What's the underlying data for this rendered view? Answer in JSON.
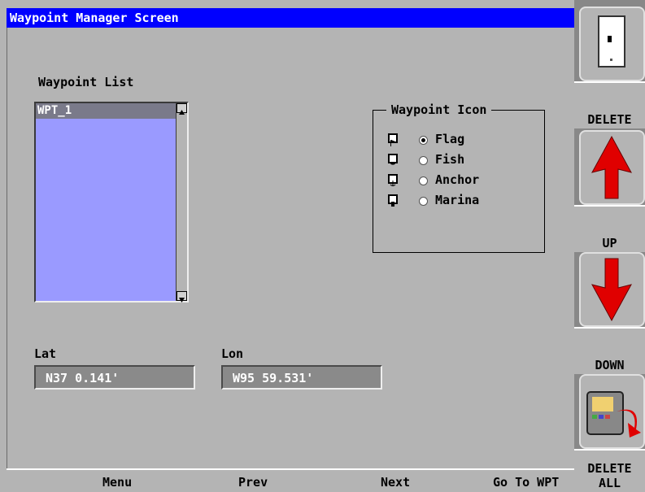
{
  "title": "Waypoint Manager Screen",
  "waypoint_list": {
    "label": "Waypoint List",
    "items": [
      "WPT_1"
    ]
  },
  "waypoint_icon": {
    "title": "Waypoint Icon",
    "options": [
      {
        "label": "Flag",
        "selected": true
      },
      {
        "label": "Fish",
        "selected": false
      },
      {
        "label": "Anchor",
        "selected": false
      },
      {
        "label": "Marina",
        "selected": false
      }
    ]
  },
  "lat": {
    "label": "Lat",
    "value": "N37 0.141'"
  },
  "lon": {
    "label": "Lon",
    "value": "W95 59.531'"
  },
  "bottom_bar": {
    "menu": "Menu",
    "prev": "Prev",
    "next": "Next",
    "goto": "Go To WPT"
  },
  "softkeys": {
    "delete": "DELETE",
    "up": "UP",
    "down": "DOWN",
    "delete_all_1": "DELETE",
    "delete_all_2": "ALL"
  },
  "colors": {
    "title_bar": "#0000ff",
    "list_bg": "#9a9aff",
    "arrow": "#e00000"
  }
}
